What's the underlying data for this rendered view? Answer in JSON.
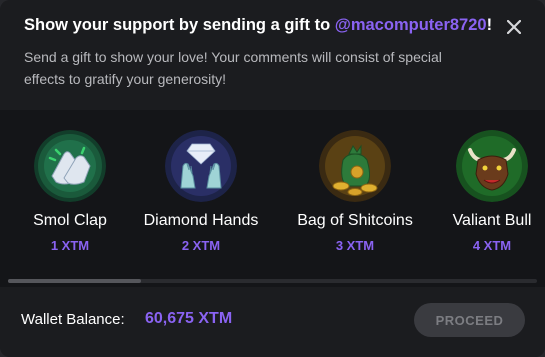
{
  "header": {
    "title_prefix": "Show your support by sending a gift to ",
    "handle": "@macomputer8720",
    "title_suffix": "!",
    "description": "Send a gift to show your love! Your comments will consist of special effects to gratify your generosity!",
    "close_icon": "close-icon"
  },
  "gifts": [
    {
      "name": "Smol Clap",
      "price": "1 XTM",
      "icon": "clapping-hands-icon"
    },
    {
      "name": "Diamond Hands",
      "price": "2 XTM",
      "icon": "diamond-hands-icon"
    },
    {
      "name": "Bag of Shitcoins",
      "price": "3 XTM",
      "icon": "coin-bag-icon"
    },
    {
      "name": "Valiant Bull",
      "price": "4 XTM",
      "icon": "bull-icon"
    }
  ],
  "footer": {
    "wallet_label": "Wallet Balance:",
    "wallet_value": "60,675 XTM",
    "proceed_label": "PROCEED"
  },
  "colors": {
    "accent": "#8a63f2",
    "background": "#1b1c1f",
    "gifts_background": "#141518"
  }
}
